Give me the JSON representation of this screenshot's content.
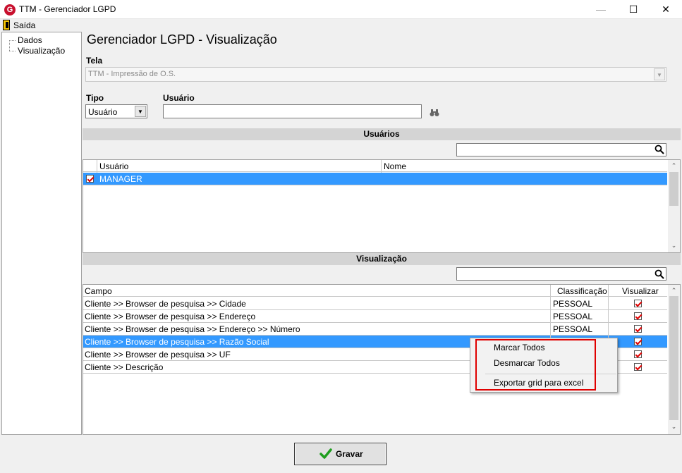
{
  "window": {
    "title": "TTM - Gerenciador LGPD",
    "icon_letter": "G",
    "min_glyph": "—",
    "max_glyph": "☐",
    "close_glyph": "✕"
  },
  "menu": {
    "exit_label": "Saída"
  },
  "tree": {
    "items": [
      "Dados",
      "Visualização"
    ]
  },
  "page": {
    "title": "Gerenciador LGPD - Visualização"
  },
  "form": {
    "tela_label": "Tela",
    "tela_value": "TTM - Impressão de O.S.",
    "tipo_label": "Tipo",
    "tipo_value": "Usuário",
    "usuario_label": "Usuário",
    "usuario_value": ""
  },
  "usuarios": {
    "section_title": "Usuários",
    "search_value": "",
    "columns": [
      "Usuário",
      "Nome"
    ],
    "rows": [
      {
        "usuario": "MANAGER",
        "nome": "",
        "checked": true
      }
    ]
  },
  "visualizacao": {
    "section_title": "Visualização",
    "search_value": "",
    "columns": [
      "Campo",
      "Classificação",
      "Visualizar"
    ],
    "rows": [
      {
        "campo": "Cliente >> Browser de pesquisa >> Cidade",
        "classificacao": "PESSOAL",
        "visualizar": true
      },
      {
        "campo": "Cliente >> Browser de pesquisa >> Endereço",
        "classificacao": "PESSOAL",
        "visualizar": true
      },
      {
        "campo": "Cliente >> Browser de pesquisa >> Endereço >> Número",
        "classificacao": "PESSOAL",
        "visualizar": true
      },
      {
        "campo": "Cliente >> Browser de pesquisa >> Razão Social",
        "classificacao": "",
        "visualizar": true
      },
      {
        "campo": "Cliente >> Browser de pesquisa >> UF",
        "classificacao": "",
        "visualizar": true
      },
      {
        "campo": "Cliente >> Descrição",
        "classificacao": "",
        "visualizar": true
      }
    ],
    "selected_row": 3
  },
  "context_menu": {
    "items": [
      "Marcar Todos",
      "Desmarcar Todos",
      "Exportar grid para excel"
    ]
  },
  "footer": {
    "save_label": "Gravar"
  },
  "colors": {
    "selection": "#3399ff",
    "highlight_border": "#e00000",
    "section_bar": "#d4d4d4"
  }
}
